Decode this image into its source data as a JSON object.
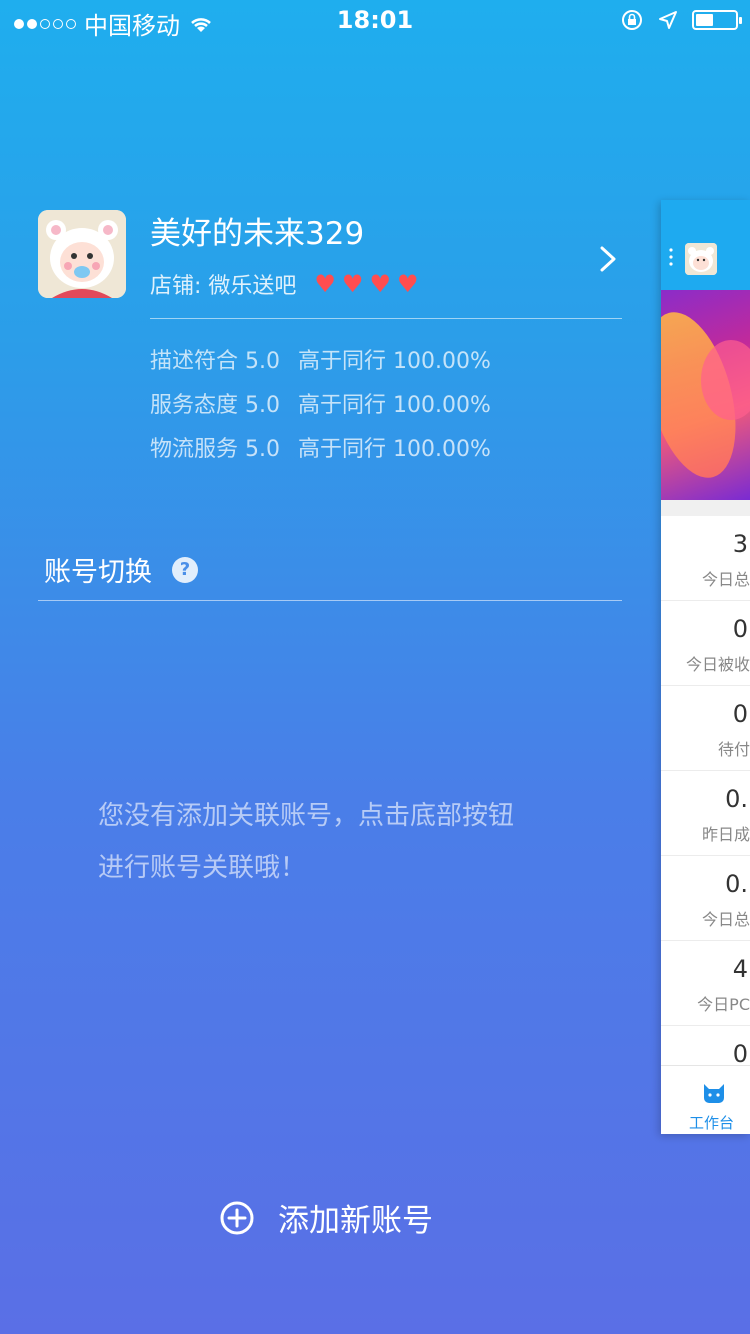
{
  "status_bar": {
    "carrier": "中国移动",
    "time": "18:01",
    "battery_level": 0.45
  },
  "profile": {
    "name": "美好的未来329",
    "shop": "店铺: 微乐送吧",
    "hearts": 4
  },
  "ratings": [
    {
      "label": "描述符合 5.0",
      "compare": "高于同行 100.00%"
    },
    {
      "label": "服务态度 5.0",
      "compare": "高于同行 100.00%"
    },
    {
      "label": "物流服务 5.0",
      "compare": "高于同行 100.00%"
    }
  ],
  "account_switch": {
    "title": "账号切换",
    "help": "?"
  },
  "empty_message": {
    "line1": "您没有添加关联账号，点击底部按钮",
    "line2": "进行账号关联哦！"
  },
  "add_button": {
    "label": "添加新账号"
  },
  "side_panel": {
    "cells": [
      {
        "value": "3",
        "label": "今日总"
      },
      {
        "value": "0",
        "label": "今日被收"
      },
      {
        "value": "0",
        "label": "待付"
      },
      {
        "value": "0.",
        "label": "昨日成"
      },
      {
        "value": "0.",
        "label": "今日总"
      },
      {
        "value": "4",
        "label": "今日PC"
      },
      {
        "value": "0",
        "label": ""
      }
    ],
    "tab_label": "工作台"
  },
  "colors": {
    "heart": "#ff4d4f",
    "tab_active": "#1e8fe8",
    "panel_header": "#1eaaf0"
  }
}
